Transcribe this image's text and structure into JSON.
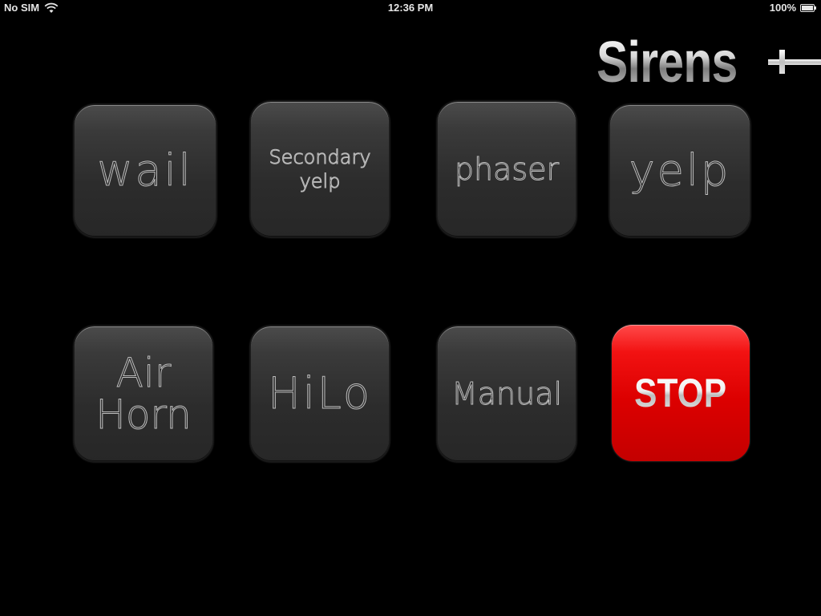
{
  "status_bar": {
    "carrier": "No SIM",
    "time": "12:36 PM",
    "battery_percent": "100%",
    "icons": [
      "wifi-icon",
      "battery-icon"
    ]
  },
  "app": {
    "logo_text": "Sirens",
    "logo_suffix": "+"
  },
  "buttons": {
    "wail": "wail",
    "secondary_yelp_line1": "Secondary",
    "secondary_yelp_line2": "yelp",
    "phaser": "phaser",
    "yelp": "yelp",
    "air_horn_line1": "Air",
    "air_horn_line2": "Horn",
    "hilo": "HiLo",
    "manual": "Manual",
    "stop": "STOP"
  },
  "colors": {
    "background": "#000000",
    "button_dark": "#2c2c2c",
    "stop_red": "#dc0000"
  }
}
